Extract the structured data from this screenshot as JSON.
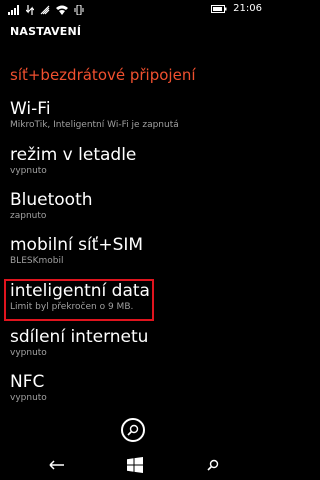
{
  "status_bar": {
    "time": "21:06",
    "icons": [
      "battery-level-icon",
      "signal-strength-icon",
      "mobile-data-icon",
      "wifi-icon",
      "hotspot-icon"
    ]
  },
  "header": {
    "title": "NASTAVENÍ"
  },
  "section": {
    "title": "síť+bezdrátové připojení"
  },
  "items": [
    {
      "label": "Wi-Fi",
      "sub": "MikroTik, Inteligentní Wi-Fi je zapnutá"
    },
    {
      "label": "režim v letadle",
      "sub": "vypnuto"
    },
    {
      "label": "Bluetooth",
      "sub": "zapnuto"
    },
    {
      "label": "mobilní síť+SIM",
      "sub": "BLESKmobil"
    },
    {
      "label": "inteligentní data",
      "sub": "Limit byl překročen o 9 MB."
    },
    {
      "label": "sdílení internetu",
      "sub": "vypnuto"
    },
    {
      "label": "NFC",
      "sub": "vypnuto"
    }
  ],
  "colors": {
    "accent": "#f0502f",
    "highlight": "#e0141e",
    "subtext": "#a0a0a0",
    "background": "#000000"
  },
  "nav": {
    "icons": [
      "back-icon",
      "windows-start-icon",
      "search-icon"
    ]
  }
}
